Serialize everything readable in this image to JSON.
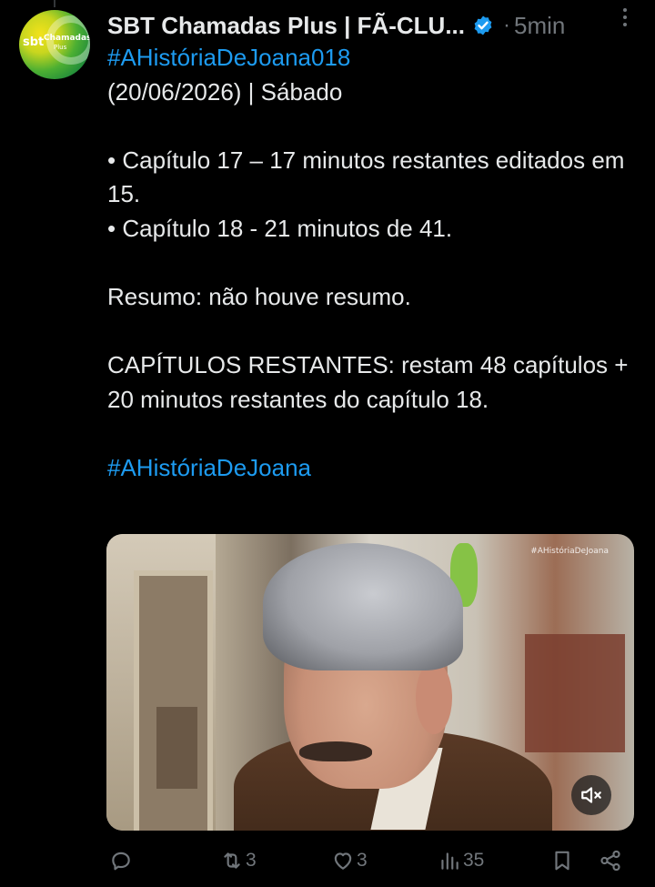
{
  "colors": {
    "background": "#000000",
    "text": "#e7e9ea",
    "muted": "#71767b",
    "link": "#1d9bf0",
    "verified": "#1d9bf0"
  },
  "author": {
    "display_name": "SBT Chamadas Plus | FÃ-CLU...",
    "time": "5min",
    "avatar_text": {
      "sbt": "sbt",
      "chamadas": "Chamadas",
      "plus": "Plus"
    }
  },
  "tweet": {
    "hashtag_top": "#AHistóriaDeJoana018",
    "date_line": "(20/06/2026) | Sábado",
    "bullet_1": "• Capítulo 17 – 17 minutos restantes editados em 15.",
    "bullet_2": "• Capítulo 18 - 21 minutos de 41.",
    "summary": "Resumo: não houve resumo.",
    "remaining": "CAPÍTULOS RESTANTES: restam 48 capítulos + 20 minutos restantes do capítulo 18.",
    "hashtag_bottom": "#AHistóriaDeJoana"
  },
  "media": {
    "watermark": "#AHistóriaDeJoana",
    "mute_icon": "speaker-muted-icon"
  },
  "actions": {
    "reply": {
      "icon": "reply-icon",
      "count": ""
    },
    "retweet": {
      "icon": "retweet-icon",
      "count": "3"
    },
    "like": {
      "icon": "heart-icon",
      "count": "3"
    },
    "views": {
      "icon": "views-icon",
      "count": "35"
    },
    "bookmark": {
      "icon": "bookmark-icon"
    },
    "share": {
      "icon": "share-icon"
    }
  }
}
